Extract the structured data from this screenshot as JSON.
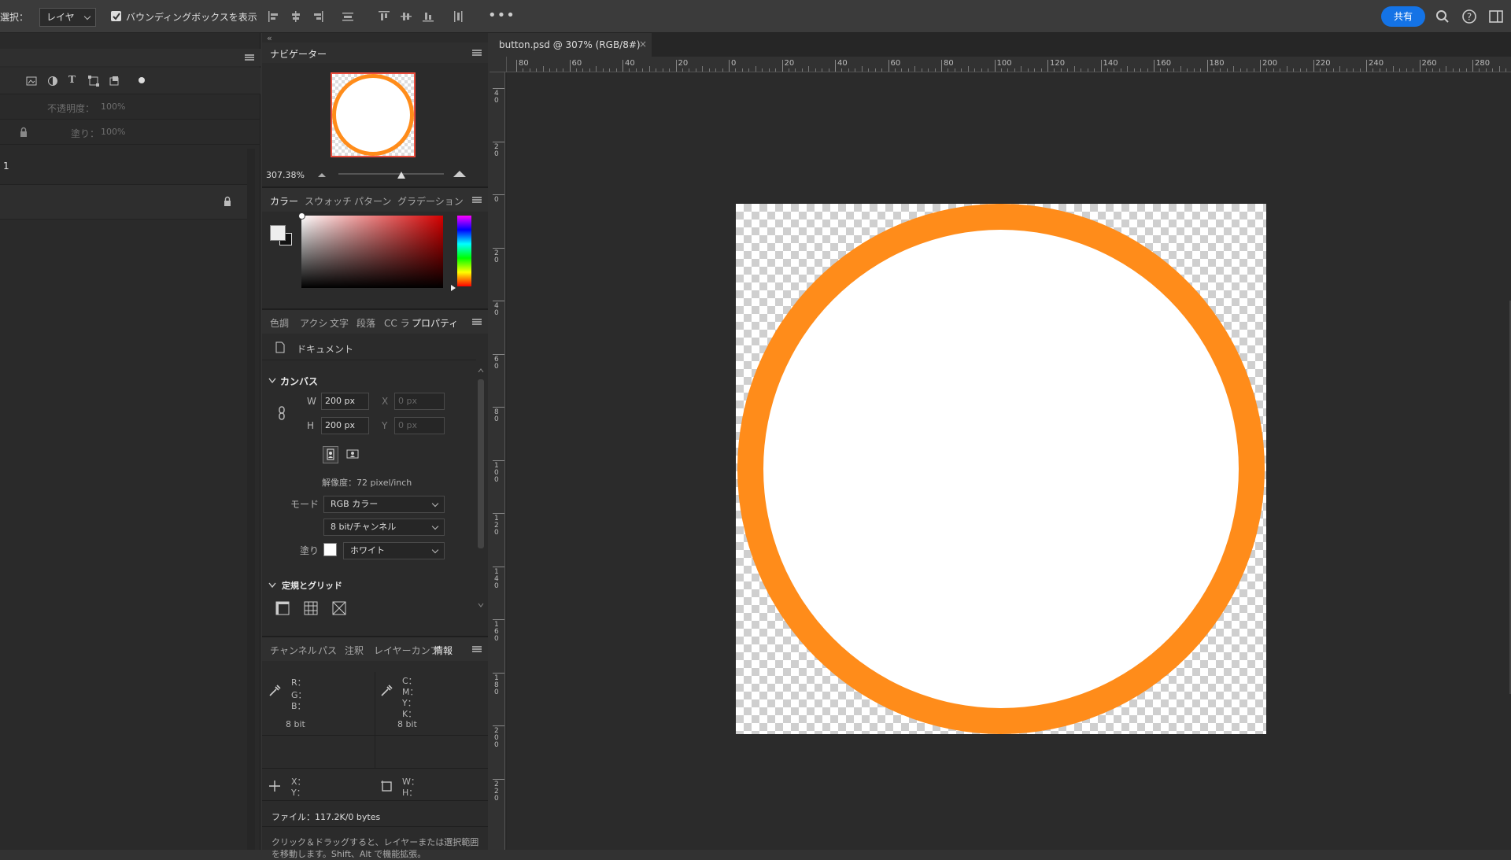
{
  "options_bar": {
    "select_label": "選択：",
    "select_value": "レイヤー",
    "bbox_label": "バウンディングボックスを表示",
    "share_label": "共有"
  },
  "layers_panel": {
    "opacity_label": "不透明度：",
    "opacity_value": "100%",
    "fill_label": "塗り：",
    "fill_value": "100%",
    "layer_name": "1"
  },
  "navigator": {
    "title": "ナビゲーター",
    "zoom": "307.38%",
    "zoom_fraction": 0.6
  },
  "color_panel": {
    "tabs": [
      "カラー",
      "スウォッチ",
      "パターン",
      "グラデーション"
    ]
  },
  "properties_panel": {
    "tabs": [
      "色調",
      "アクシ",
      "文字",
      "段落",
      "CC ラ",
      "プロパティ"
    ],
    "doc_label": "ドキュメント",
    "canvas_section": "カンバス",
    "w_label": "W",
    "w_value": "200 px",
    "h_label": "H",
    "h_value": "200 px",
    "x_label": "X",
    "x_placeholder": "0 px",
    "y_label": "Y",
    "y_placeholder": "0 px",
    "resolution": "解像度：72 pixel/inch",
    "mode_label": "モード",
    "mode_value": "RGB カラー",
    "depth_value": "8 bit/チャンネル",
    "fill_label": "塗り",
    "fill_value": "ホワイト",
    "rulers_section": "定規とグリッド"
  },
  "info_panel": {
    "tabs": [
      "チャンネル",
      "パス",
      "注釈",
      "レイヤーカンプ",
      "情報"
    ],
    "rgb_labels": [
      "R：",
      "G：",
      "B："
    ],
    "cmyk_labels": [
      "C：",
      "M：",
      "Y：",
      "K："
    ],
    "bit_left": "8 bit",
    "bit_right": "8 bit",
    "xy_labels": [
      "X：",
      "Y："
    ],
    "wh_labels": [
      "W：",
      "H："
    ],
    "file_info": "ファイル：117.2K/0 bytes",
    "hint_line1": "クリック＆ドラッグすると、レイヤーまたは選択範囲",
    "hint_line2": "を移動します。Shift、Alt で機能拡張。"
  },
  "document": {
    "tab_title": "button.psd @ 307% (RGB/8#)",
    "ruler_ticks": [
      "80",
      "60",
      "40",
      "20",
      "0",
      "20",
      "40",
      "60",
      "80",
      "100",
      "120",
      "140",
      "160",
      "180",
      "200",
      "220",
      "240",
      "260",
      "280"
    ],
    "ruler_v_ticks": [
      "4\n0",
      "2\n0",
      "0",
      "2\n0",
      "4\n0",
      "6\n0",
      "8\n0",
      "1\n0\n0",
      "1\n2\n0",
      "1\n4\n0",
      "1\n6\n0",
      "1\n8\n0",
      "2\n0\n0",
      "2\n2\n0"
    ]
  },
  "colors": {
    "accent": "#1473e6",
    "circle_stroke": "#ff8c1a",
    "circle_fill": "#ffffff"
  }
}
